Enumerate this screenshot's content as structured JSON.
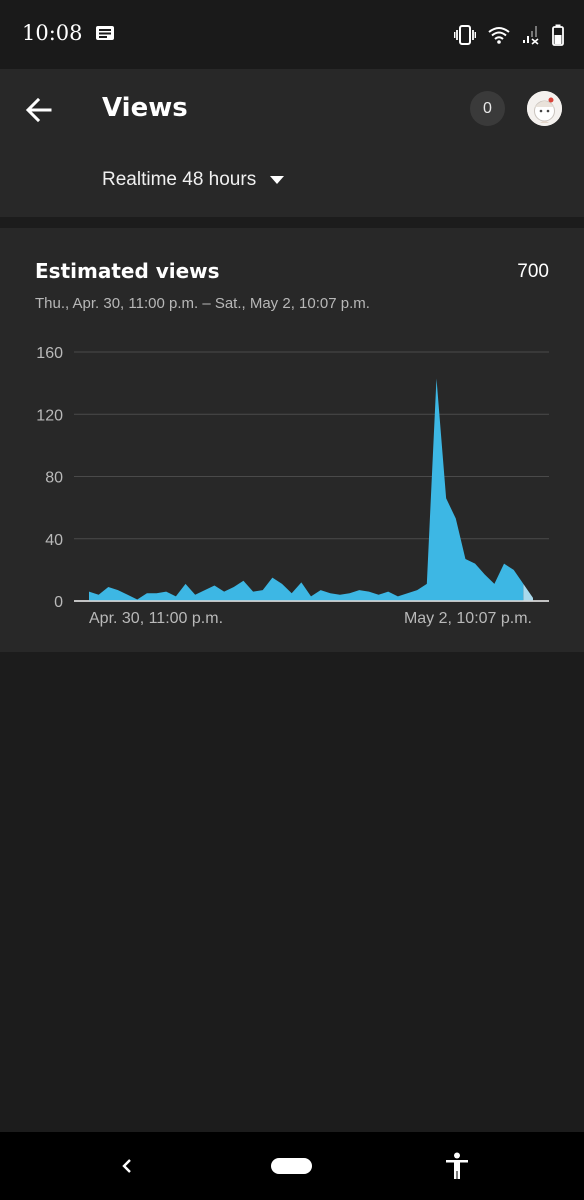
{
  "status_bar": {
    "time": "10:08",
    "icons": [
      "message-icon",
      "vibrate-icon",
      "wifi-icon",
      "signal-icon",
      "battery-icon"
    ]
  },
  "app_bar": {
    "title": "Views",
    "notification_count": "0",
    "range_selector": "Realtime 48 hours"
  },
  "card": {
    "title": "Estimated views",
    "total": "700",
    "date_range": "Thu., Apr. 30, 11:00 p.m. – Sat., May 2, 10:07 p.m."
  },
  "chart_data": {
    "type": "area",
    "title": "",
    "xlabel": "",
    "ylabel": "",
    "ylim": [
      0,
      160
    ],
    "yticks": [
      0,
      40,
      80,
      120,
      160
    ],
    "x_start_label": "Apr. 30, 11:00 p.m.",
    "x_end_label": "May 2, 10:07 p.m.",
    "grid": true,
    "color": "#3db7e4",
    "partial_color": "#a9d9ec",
    "series": [
      {
        "values": [
          6,
          4,
          9,
          7,
          4,
          1,
          5,
          5,
          6,
          3,
          11,
          4,
          7,
          10,
          6,
          9,
          13,
          6,
          7,
          15,
          11,
          5,
          12,
          3,
          7,
          5,
          4,
          5,
          7,
          6,
          4,
          6,
          3,
          5,
          7,
          11,
          143,
          66,
          53,
          27,
          24,
          17,
          11,
          24,
          20,
          11,
          2
        ]
      }
    ]
  },
  "colors": {
    "background": "#1c1c1c",
    "surface": "#282828",
    "accent": "#3db7e4"
  },
  "nav_bar": {
    "icons": [
      "back-icon",
      "home-pill",
      "accessibility-icon"
    ]
  }
}
